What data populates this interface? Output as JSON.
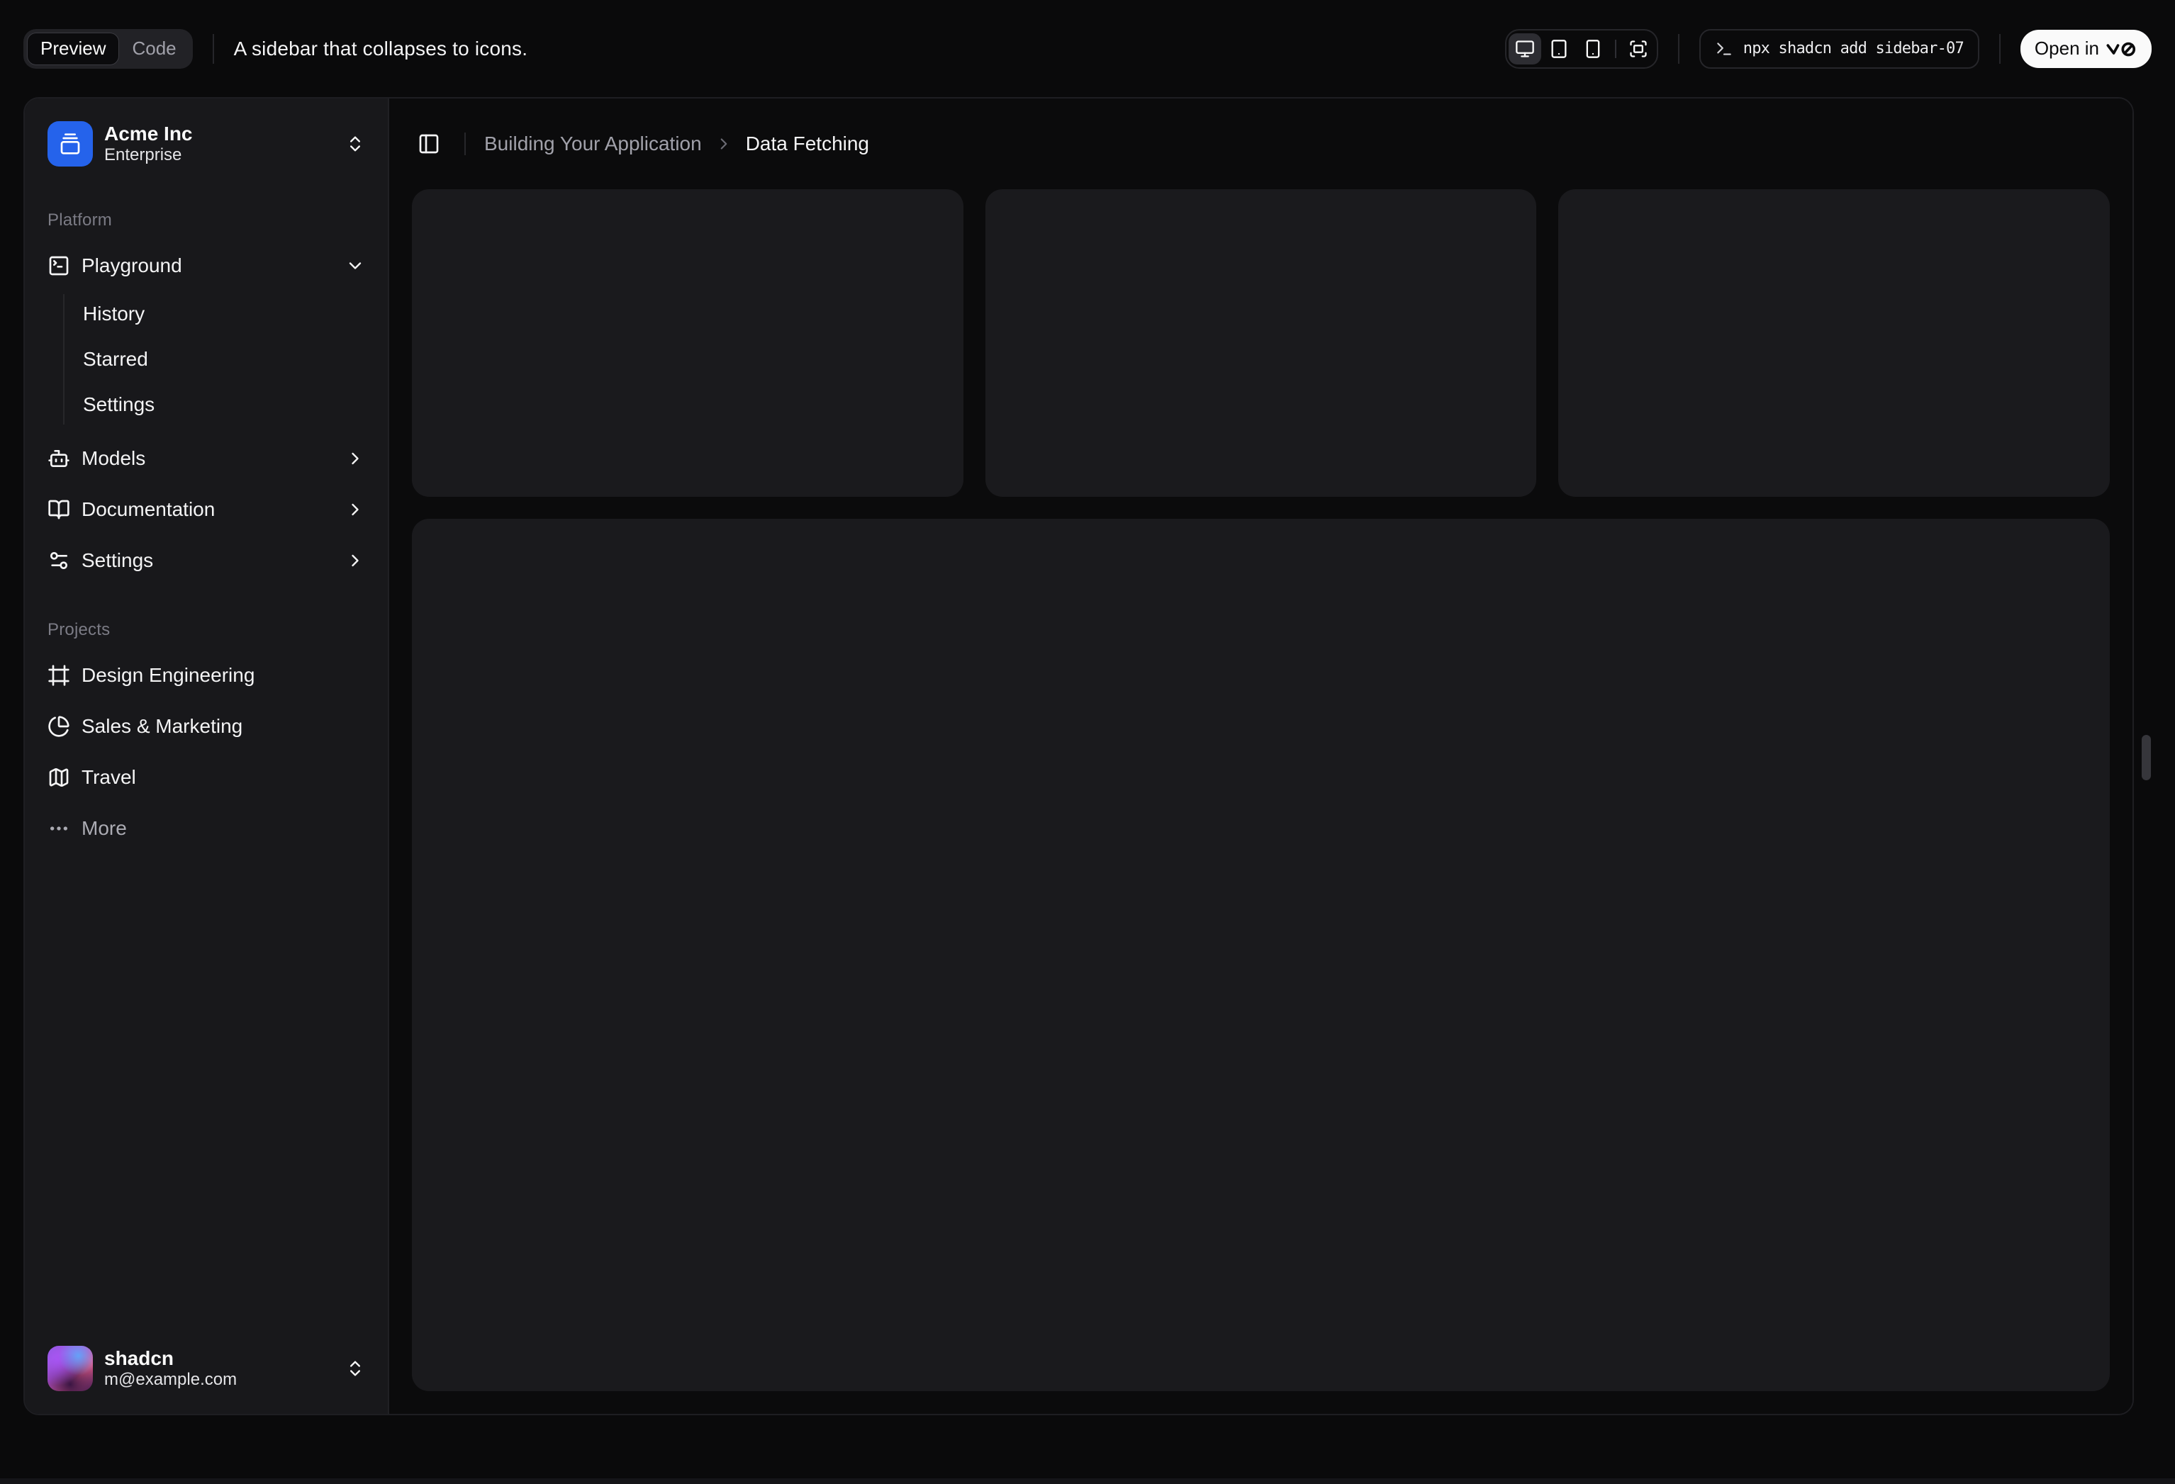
{
  "toolbar": {
    "tabs": {
      "preview": "Preview",
      "code": "Code"
    },
    "description": "A sidebar that collapses to icons.",
    "device_icons": [
      "monitor",
      "tablet",
      "smartphone",
      "fullscreen"
    ],
    "command": "npx shadcn add sidebar-07",
    "open_in": "Open in",
    "open_in_logo": "v0"
  },
  "sidebar": {
    "team": {
      "name": "Acme Inc",
      "plan": "Enterprise",
      "logo_icon": "gallery-vertical-end"
    },
    "groups": [
      {
        "label": "Platform",
        "items": [
          {
            "label": "Playground",
            "icon": "square-terminal",
            "state": "expanded",
            "children": [
              {
                "label": "History"
              },
              {
                "label": "Starred"
              },
              {
                "label": "Settings"
              }
            ]
          },
          {
            "label": "Models",
            "icon": "bot"
          },
          {
            "label": "Documentation",
            "icon": "book-open"
          },
          {
            "label": "Settings",
            "icon": "settings-2"
          }
        ]
      },
      {
        "label": "Projects",
        "items": [
          {
            "label": "Design Engineering",
            "icon": "frame"
          },
          {
            "label": "Sales & Marketing",
            "icon": "chart-pie"
          },
          {
            "label": "Travel",
            "icon": "map"
          },
          {
            "label": "More",
            "icon": "ellipsis"
          }
        ]
      }
    ],
    "user": {
      "name": "shadcn",
      "email": "m@example.com"
    }
  },
  "main": {
    "breadcrumb": {
      "section": "Building Your Application",
      "page": "Data Fetching"
    }
  },
  "colors": {
    "canvas_bg": "#0a0a0b",
    "sidebar_bg": "#18181b",
    "card_bg": "#1a1a1d",
    "accent_blue": "#2563eb",
    "open_button_bg": "#fafafa"
  }
}
